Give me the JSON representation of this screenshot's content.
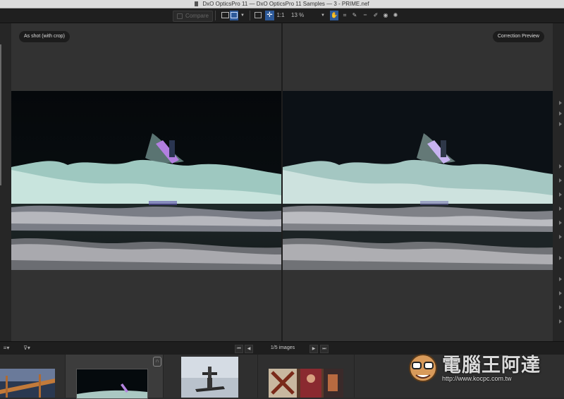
{
  "window": {
    "title": "DxO OpticsPro 11 — DxO OpticsPro 11 Samples — 3 - PRIME.nef"
  },
  "toolbar": {
    "compare_label": "Compare",
    "zoom_one_to_one": "1:1",
    "zoom_value": "13 %"
  },
  "viewer": {
    "left_label": "As shot (with crop)",
    "right_label": "Correction Preview"
  },
  "statusbar": {
    "image_count": "1/5 images"
  },
  "watermark": {
    "site_name": "電腦王阿達",
    "url": "http://www.kocpc.com.tw"
  },
  "colors": {
    "accent": "#2d5a9a",
    "background": "#2b2b2b"
  }
}
